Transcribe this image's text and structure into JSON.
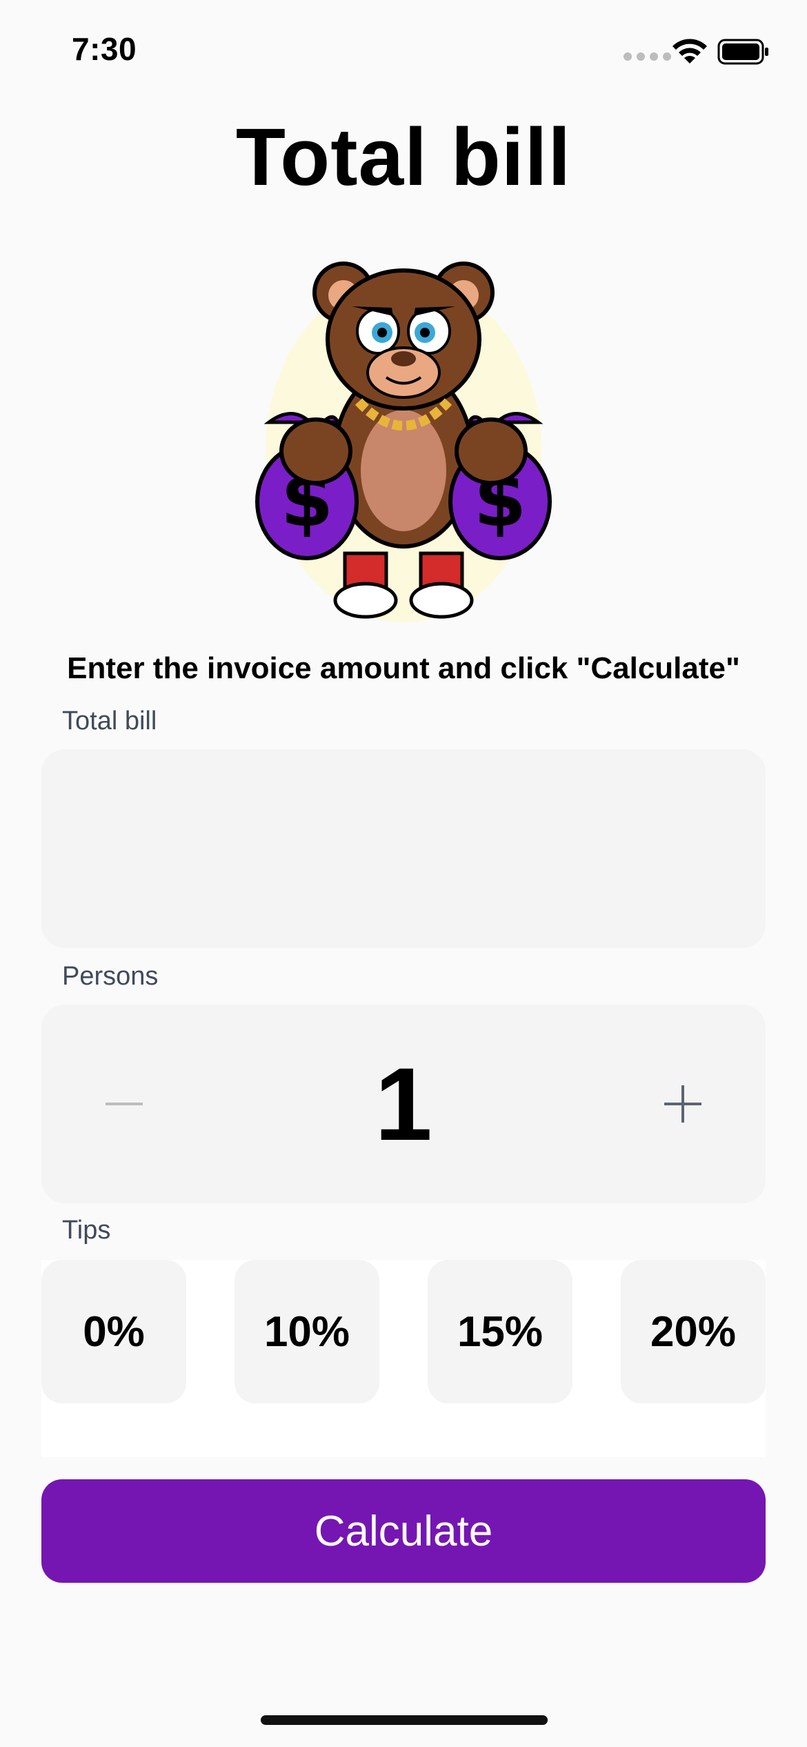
{
  "status_bar": {
    "time": "7:30"
  },
  "header": {
    "title": "Total bill"
  },
  "main": {
    "instructions": "Enter the invoice amount and click \"Calculate\"",
    "total_bill": {
      "label": "Total bill",
      "value": "",
      "placeholder": ""
    },
    "persons": {
      "label": "Persons",
      "value": "1",
      "decrement_icon": "minus-icon",
      "increment_icon": "plus-icon"
    },
    "tips": {
      "label": "Tips",
      "options": [
        "0%",
        "10%",
        "15%",
        "20%"
      ]
    },
    "calculate_label": "Calculate"
  },
  "colors": {
    "accent": "#7516b3",
    "background": "#fafafa",
    "field_background": "#f4f4f4"
  }
}
